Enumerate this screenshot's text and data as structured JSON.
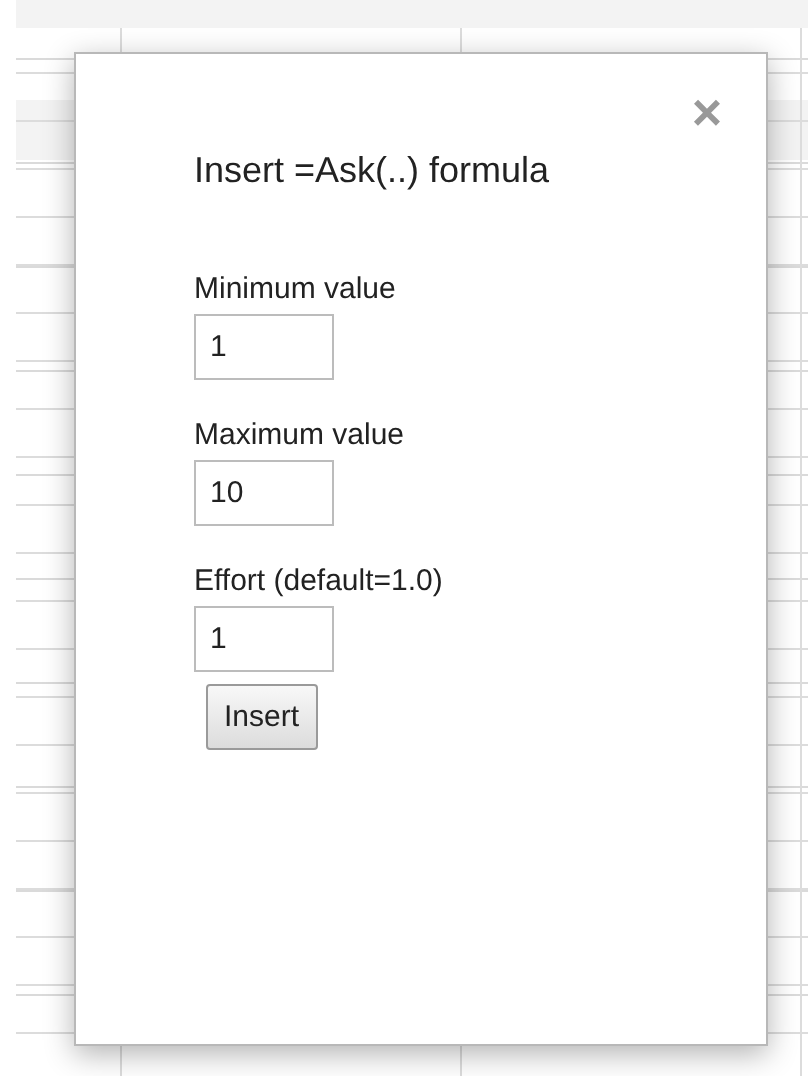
{
  "dialog": {
    "title": "Insert =Ask(..) formula",
    "close": "×",
    "fields": [
      {
        "label": "Minimum value",
        "value": "1"
      },
      {
        "label": "Maximum value",
        "value": "10"
      },
      {
        "label": "Effort (default=1.0)",
        "value": "1"
      }
    ],
    "button": "Insert"
  }
}
